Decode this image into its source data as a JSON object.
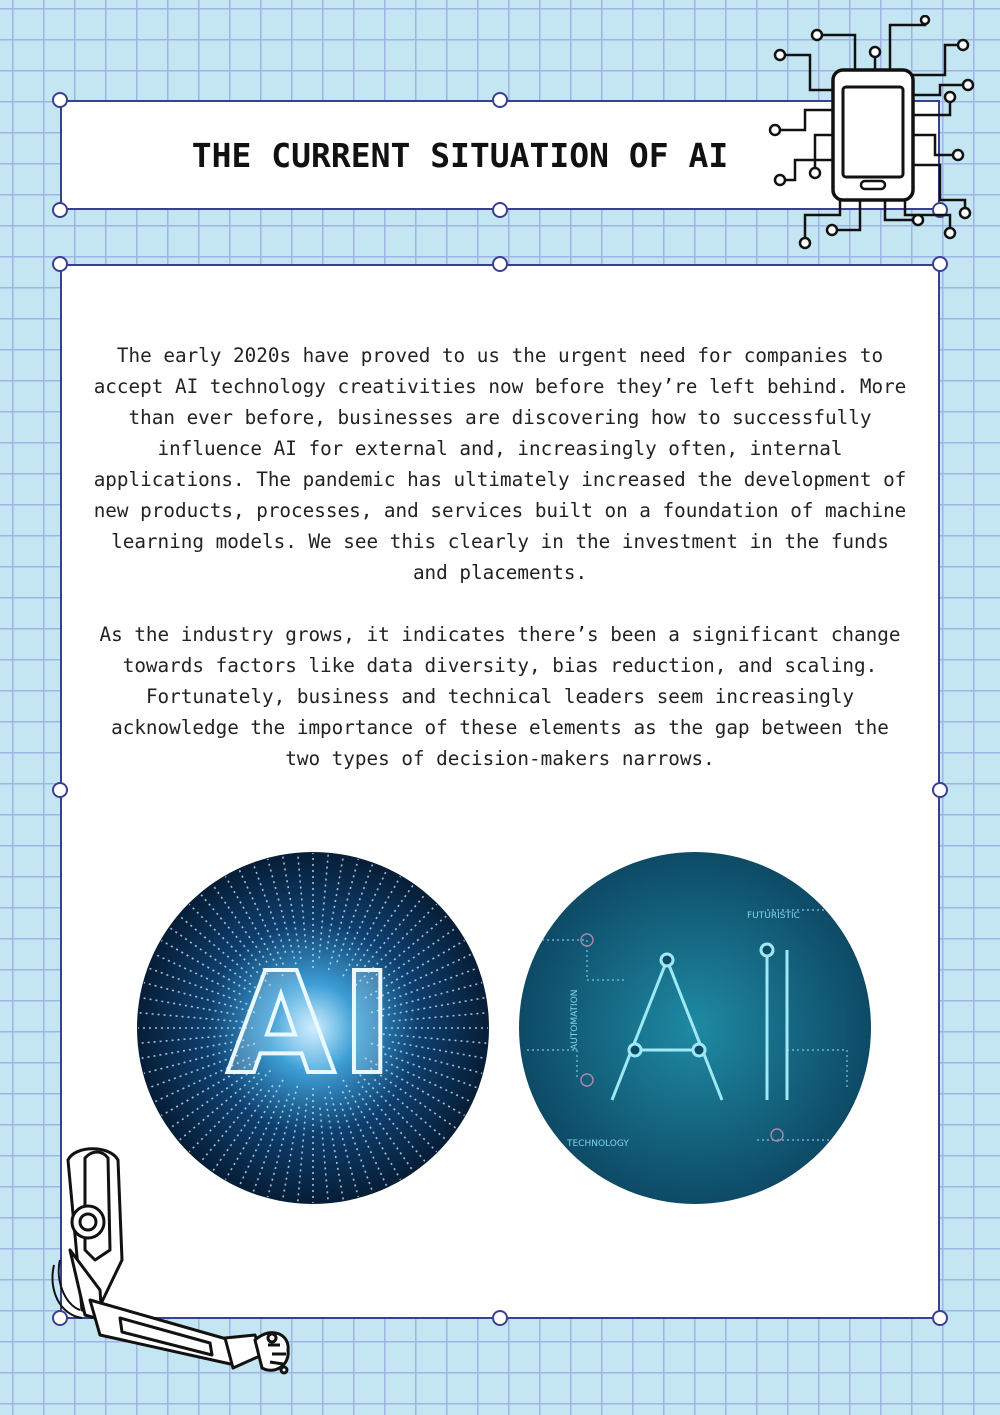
{
  "header": {
    "title": "THE CURRENT SITUATION OF AI"
  },
  "content": {
    "paragraphs": [
      "The early 2020s have proved to us the urgent need for companies to accept AI technology creativities now before they’re left behind. More than ever before, businesses are discovering how to successfully influence AI for external and, increasingly often, internal applications. The pandemic has ultimately increased the development of new products, processes, and services built on a foundation of machine learning models. We see this clearly in the investment in the funds and placements.",
      "As the industry grows, it indicates there’s been a significant change towards factors like data diversity, bias reduction, and scaling. Fortunately, business and technical leaders seem increasingly acknowledge the importance of these elements as the gap between the two types of decision-makers narrows."
    ]
  },
  "images": {
    "left": {
      "label": "AI"
    },
    "right": {
      "label": "AI",
      "tags": [
        "FUTURISTIC",
        "AUTOMATION",
        "TECHNOLOGY"
      ]
    }
  },
  "icons": {
    "top_right": "phone-circuit-icon",
    "bottom_left": "robot-arm-icon"
  },
  "colors": {
    "background": "#c4e6f2",
    "grid": "#9fb4e6",
    "frame_border": "#3b3f8f",
    "panel": "#ffffff"
  }
}
